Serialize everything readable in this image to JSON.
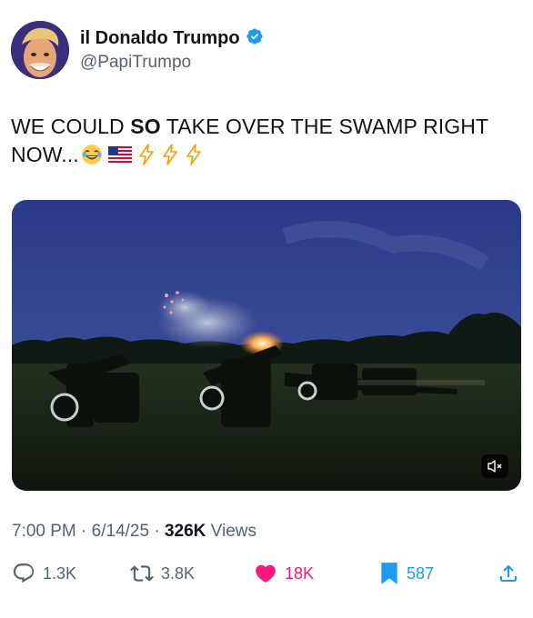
{
  "author": {
    "display_name": "il Donaldo Trumpo",
    "handle": "@PapiTrumpo",
    "verified": true
  },
  "tweet": {
    "text_part1": "WE COULD ",
    "text_bold": "SO",
    "text_part2": " TAKE OVER THE SWAMP RIGHT NOW...",
    "emojis": [
      "laughing-emoji",
      "us-flag-emoji",
      "lightning-emoji",
      "lightning-emoji",
      "lightning-emoji"
    ]
  },
  "media": {
    "type": "video",
    "muted": true
  },
  "meta": {
    "time": "7:00 PM",
    "date": "6/14/25",
    "views_count": "326K",
    "views_label": "Views"
  },
  "actions": {
    "replies": "1.3K",
    "reposts": "3.8K",
    "likes": "18K",
    "bookmarks": "587"
  },
  "colors": {
    "text": "#0f1419",
    "secondary": "#536471",
    "verified": "#1d9bf0",
    "like": "#f91880",
    "bookmark": "#1d9bf0"
  }
}
